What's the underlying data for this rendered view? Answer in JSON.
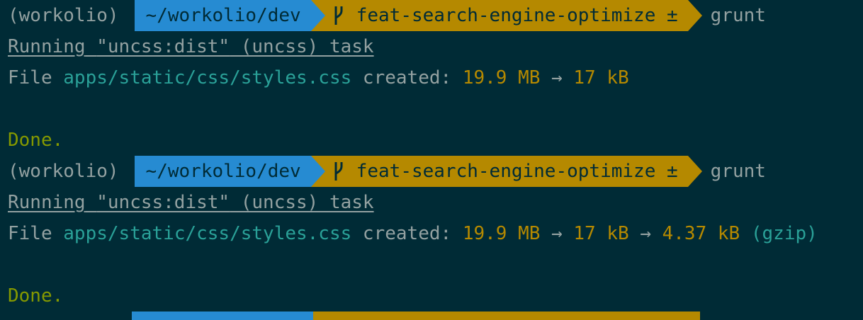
{
  "prompt": {
    "venv": "(workolio)",
    "dir": "~/workolio/dev",
    "branch": "feat-search-engine-optimize ±",
    "command": "grunt"
  },
  "blocks": [
    {
      "running_label": "Running",
      "running_task": "\"uncss:dist\"",
      "running_rest": " (uncss) task",
      "file_label": "File ",
      "file_path": "apps/static/css/styles.css",
      "created_label": " created: ",
      "size_original": "19.9 MB",
      "arrow": " → ",
      "size_min": "17 kB",
      "size_gzip": "",
      "gzip_label": "",
      "done": "Done."
    },
    {
      "running_label": "Running",
      "running_task": "\"uncss:dist\"",
      "running_rest": " (uncss) task",
      "file_label": "File ",
      "file_path": "apps/static/css/styles.css",
      "created_label": " created: ",
      "size_original": "19.9 MB",
      "arrow": " → ",
      "size_min": "17 kB",
      "arrow2": " → ",
      "size_gzip": "4.37 kB",
      "gzip_label": " (gzip)",
      "done": "Done."
    }
  ],
  "colors": {
    "background": "#002b36",
    "dir_segment": "#268bd2",
    "git_segment": "#b58900",
    "path": "#2aa198",
    "size": "#b58900",
    "done": "#859900"
  },
  "icons": {
    "branch": "git-branch-icon"
  }
}
